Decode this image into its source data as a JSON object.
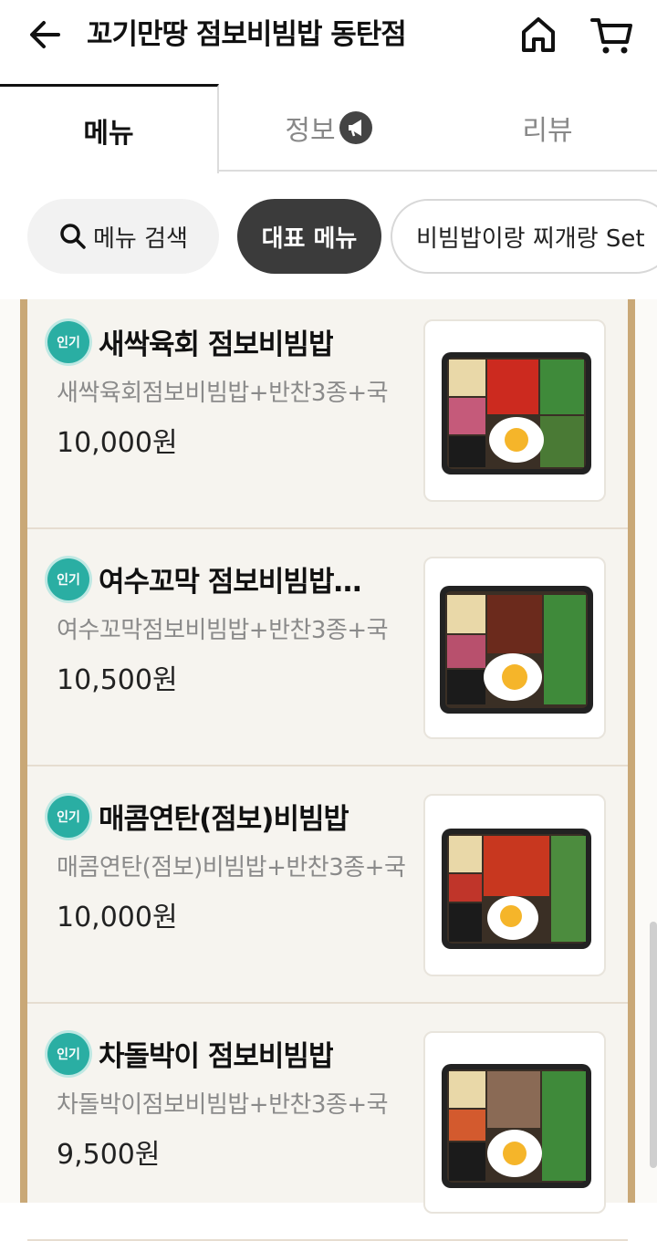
{
  "header": {
    "title": "꼬기만땅 점보비빔밥 동탄점"
  },
  "tabs": [
    {
      "label": "메뉴"
    },
    {
      "label": "정보"
    },
    {
      "label": "리뷰"
    }
  ],
  "chips": {
    "search_label": "메뉴 검색",
    "representative": "대표 메뉴",
    "set": "비빔밥이랑 찌개랑 Set"
  },
  "menu_items": [
    {
      "badge": "인기",
      "name": "새싹육회 점보비빔밥",
      "description": "새싹육회점보비빔밥+반찬3종+국",
      "price": "10,000원"
    },
    {
      "badge": "인기",
      "name": "여수꼬막 점보비빔밥…",
      "description": "여수꼬막점보비빔밥+반찬3종+국",
      "price": "10,500원"
    },
    {
      "badge": "인기",
      "name": "매콤연탄(점보)비빔밥",
      "description": "매콤연탄(점보)비빔밥+반찬3종+국",
      "price": "10,000원"
    },
    {
      "badge": "인기",
      "name": "차돌박이 점보비빔밥",
      "description": "차돌박이점보비빔밥+반찬3종+국",
      "price": "9,500원"
    }
  ],
  "icons": {
    "back": "arrow-left-icon",
    "home": "home-icon",
    "cart": "cart-icon",
    "info_tab": "megaphone-icon",
    "search": "search-icon"
  },
  "colors": {
    "badge": "#2aaea3",
    "frame": "#c9a877",
    "active_chip": "#3b3b3b"
  }
}
